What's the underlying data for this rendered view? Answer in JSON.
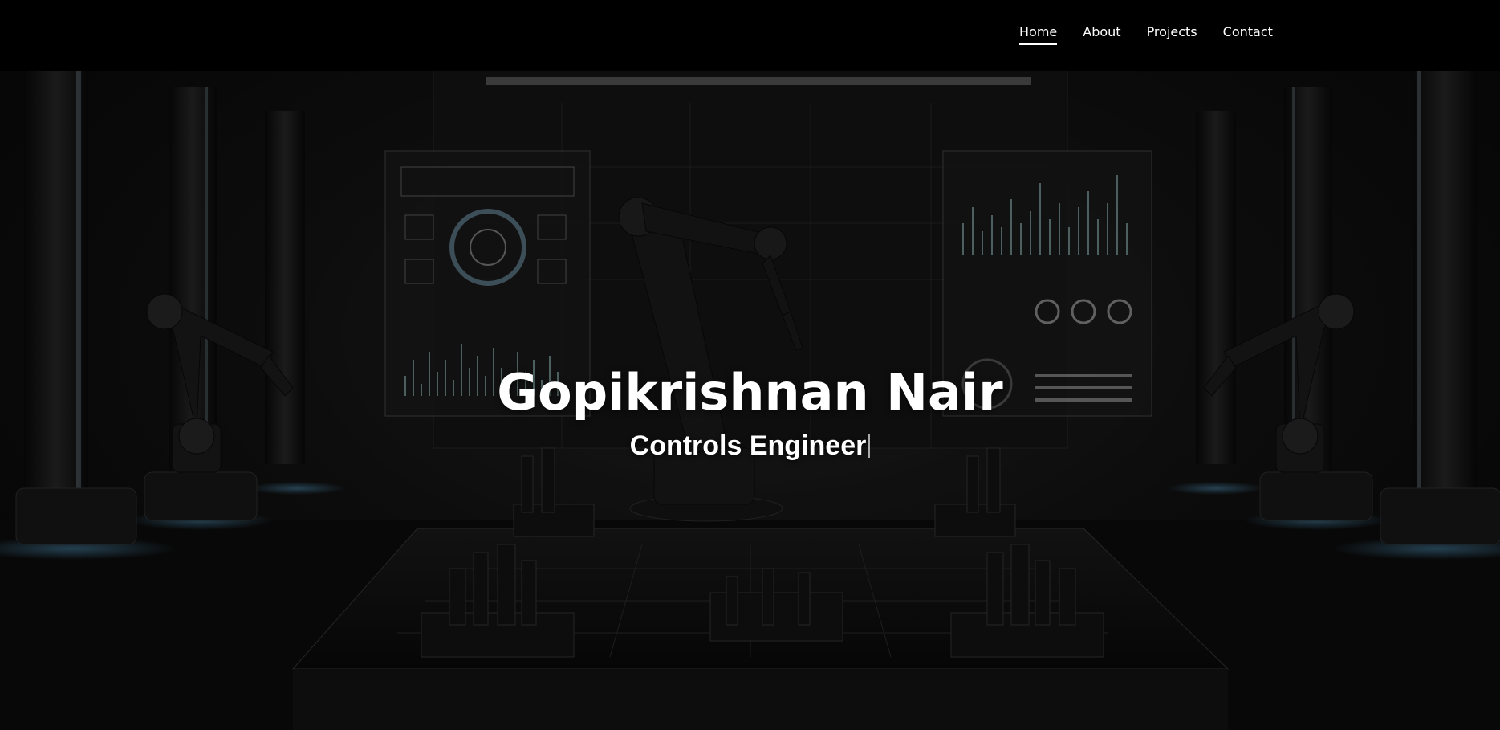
{
  "nav": {
    "items": [
      {
        "label": "Home",
        "active": true
      },
      {
        "label": "About",
        "active": false
      },
      {
        "label": "Projects",
        "active": false
      },
      {
        "label": "Contact",
        "active": false
      }
    ]
  },
  "hero": {
    "name": "Gopikrishnan Nair",
    "role": "Controls Engineer",
    "background": "dark robotics lab with robotic arms and dashboard screens"
  },
  "colors": {
    "nav_bg": "#000000",
    "text": "#ffffff",
    "accent_glow": "#5aa9d6"
  }
}
